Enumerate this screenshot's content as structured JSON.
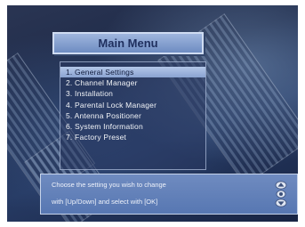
{
  "header": {
    "title": "Main Menu"
  },
  "menu": {
    "items": [
      {
        "label": "1. General Settings",
        "selected": true
      },
      {
        "label": "2. Channel Manager",
        "selected": false
      },
      {
        "label": "3. Installation",
        "selected": false
      },
      {
        "label": "4. Parental Lock Manager",
        "selected": false
      },
      {
        "label": "5. Antenna Positioner",
        "selected": false
      },
      {
        "label": "6. System Information",
        "selected": false
      },
      {
        "label": "7. Factory Preset",
        "selected": false
      }
    ]
  },
  "help": {
    "line1": "Choose the setting you wish to change",
    "line2": "with [Up/Down] and select with [OK]",
    "icons": [
      "up-arrow-icon",
      "ok-icon",
      "down-arrow-icon"
    ]
  },
  "colors": {
    "background": "#1e2a48",
    "title_box": "#7f9bcf",
    "title_text": "#1f2f5e",
    "highlight": "#a5b9e0",
    "help_box": "#6482bb"
  }
}
